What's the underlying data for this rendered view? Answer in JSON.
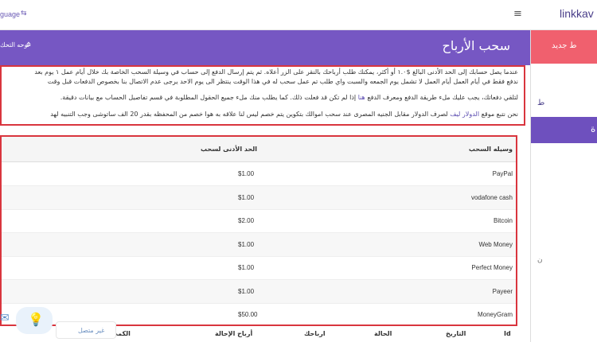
{
  "header": {
    "brand": "linkkav",
    "language_label": "guage",
    "menu_icon": "hamburger-icon",
    "lang_icon": "translate-icon"
  },
  "sidebar": {
    "new_label": "ط جديد",
    "item_label": "ط",
    "active_label": "ة",
    "rest_label": "ن",
    "colors": {
      "red": "#f0606e",
      "purple": "#6e50be"
    }
  },
  "page": {
    "title": "سحب الأرباح",
    "dashboard_link": "لوحه التحك"
  },
  "notice": {
    "line1": "عندما يصل حسابك إلى الحد الأدنى البالغ $۱.۰ أو أكثر، يمكنك طلب أرباحك بالنقر على الزر أعلاه. ثم يتم إرسال الدفع إلى حساب في وسيلة السحب الخاصة بك خلال أيام عمل ۱ يوم بعد",
    "line2": "ندفع فقط في أيام العمل أيام العمل لا تشمل يوم الجمعه والسبت واي طلب تم عمل سحب له في هذا الوقت ينتظر الى يوم الاحد يرجى عدم الاتصال بنا بخصوص الدفعات قبل وقت",
    "line3_pre": "لتلقي دفعاتك، يجب عليك ملء طريقة الدفع ومعرف الدفع",
    "line3_link": "هنا",
    "line3_post": "إذا لم تكن قد فعلت ذلك. كما يطلب منك ملء جميع الحقول المطلوبة في قسم تفاصيل الحساب مع بيانات دقيقة.",
    "line4_pre": "نحن نتبع موقع",
    "line4_link": "الدولار ليف",
    "line4_post": "لصرف الدولار مقابل الجنيه المصرى عند سحب اموالك بتكوين يتم خصم ليس لنا علاقه به هوا خصم من المحفظه بقدر 20 الف ساتوشى وجب التنبيه لهد"
  },
  "methods_table": {
    "headers": {
      "method": "وسيله السحب",
      "min": "الحد الأدنى لسحب"
    },
    "rows": [
      {
        "method": "PayPal",
        "min": "$1.00"
      },
      {
        "method": "vodafone cash",
        "min": "$1.00"
      },
      {
        "method": "Bitcoin",
        "min": "$2.00"
      },
      {
        "method": "Web Money",
        "min": "$1.00"
      },
      {
        "method": "Perfect Money",
        "min": "$1.00"
      },
      {
        "method": "Payeer",
        "min": "$1.00"
      },
      {
        "method": "MoneyGram",
        "min": "$50.00"
      }
    ]
  },
  "withdrawals_table": {
    "headers": {
      "id": "Id",
      "date": "التاريخ",
      "status": "الحالة",
      "earnings": "ارباحك",
      "referral": "أرباح الإحالة",
      "amount": "الكمي"
    }
  },
  "widgets": {
    "offline_label": "غير متصل",
    "bulb_icon": "lightbulb-icon",
    "chat_icon": "chat-icon"
  }
}
